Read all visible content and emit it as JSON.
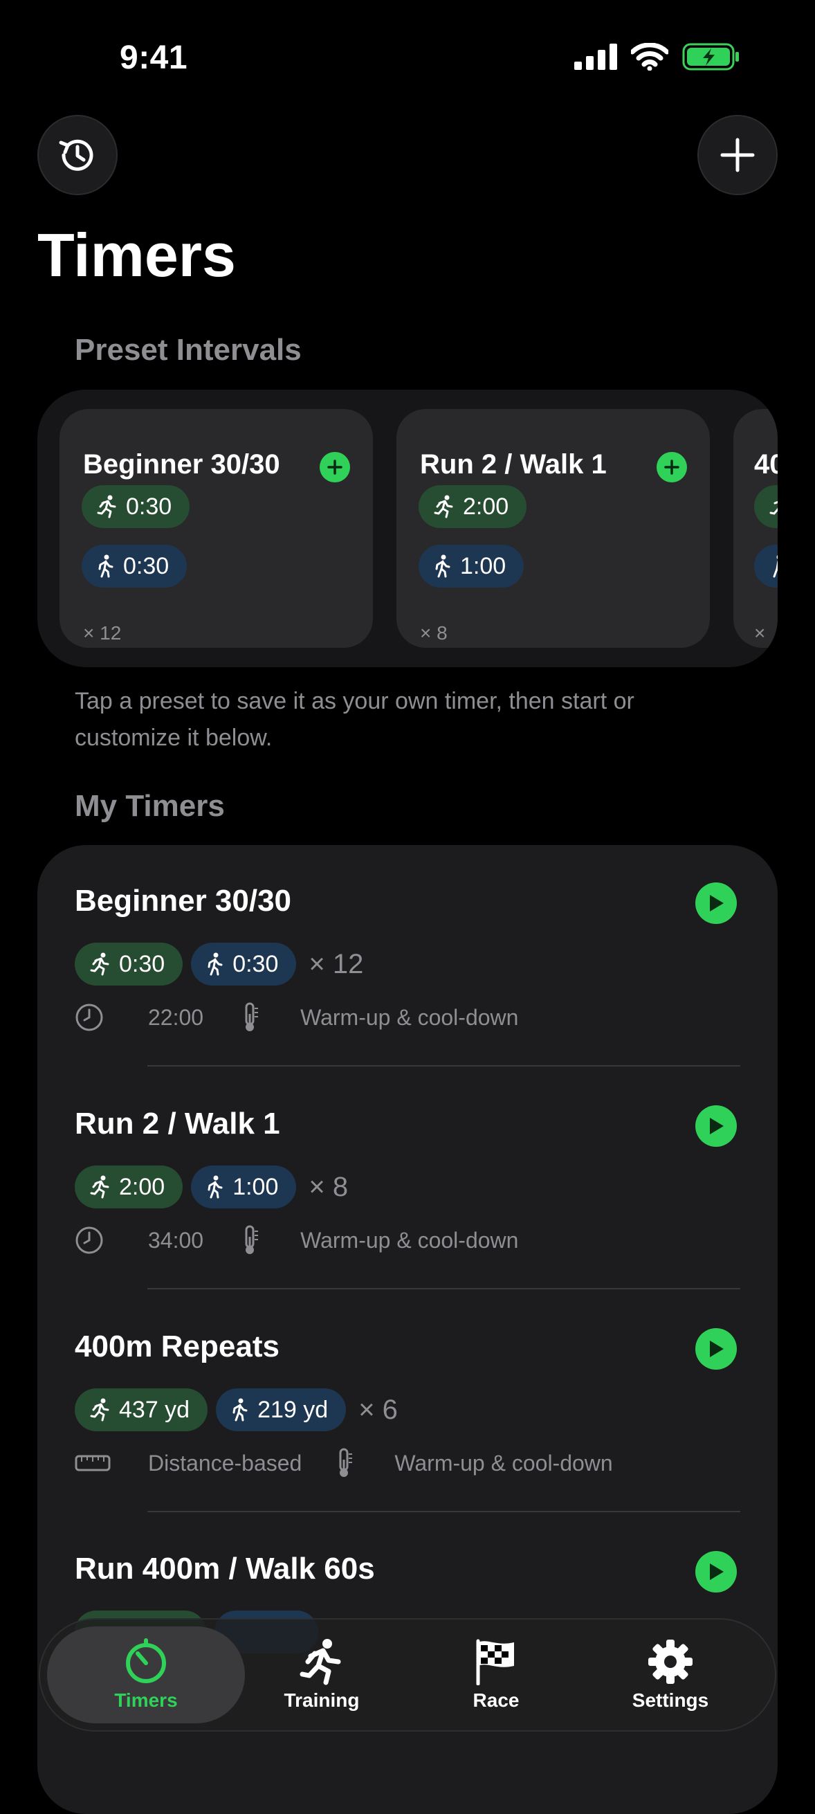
{
  "status": {
    "time": "9:41"
  },
  "header": {
    "title": "Timers"
  },
  "presets": {
    "section_title": "Preset Intervals",
    "items": [
      {
        "name": "Beginner 30/30",
        "run": "0:30",
        "walk": "0:30",
        "reps": "× 12"
      },
      {
        "name": "Run 2 / Walk 1",
        "run": "2:00",
        "walk": "1:00",
        "reps": "× 8"
      },
      {
        "name": "40",
        "reps": "×"
      }
    ],
    "hint": "Tap a preset to save it as your own timer, then start or customize it below."
  },
  "my_timers": {
    "section_title": "My Timers",
    "items": [
      {
        "name": "Beginner 30/30",
        "run": "0:30",
        "walk": "0:30",
        "reps": "× 12",
        "meta1": "22:00",
        "meta2": "Warm-up & cool-down"
      },
      {
        "name": "Run 2 / Walk 1",
        "run": "2:00",
        "walk": "1:00",
        "reps": "× 8",
        "meta1": "34:00",
        "meta2": "Warm-up & cool-down"
      },
      {
        "name": "400m Repeats",
        "run": "437 yd",
        "walk": "219 yd",
        "reps": "× 6",
        "meta1": "Distance-based",
        "meta2": "Warm-up & cool-down"
      },
      {
        "name": "Run 400m / Walk 60s"
      }
    ]
  },
  "tabbar": {
    "tabs": [
      {
        "label": "Timers",
        "icon": "timer-icon",
        "active": true
      },
      {
        "label": "Training",
        "icon": "runner-icon"
      },
      {
        "label": "Race",
        "icon": "checkered-flag-icon"
      },
      {
        "label": "Settings",
        "icon": "gear-icon"
      }
    ]
  },
  "colors": {
    "accent": "#30d158",
    "run_pill": "#264c31",
    "walk_pill": "#1d3652",
    "background": "#000000",
    "card": "#1c1c1e"
  }
}
